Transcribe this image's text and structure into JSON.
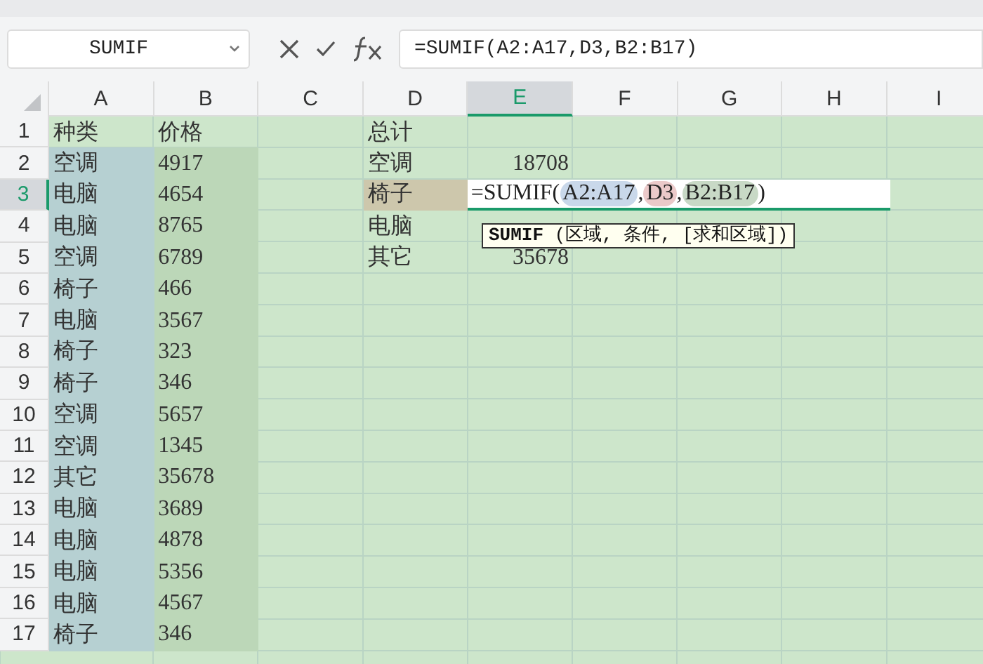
{
  "name_box": {
    "value": "SUMIF"
  },
  "formula_bar": {
    "value": "=SUMIF(A2:A17,D3,B2:B17)"
  },
  "columns": [
    {
      "label": "A",
      "selected": false
    },
    {
      "label": "B",
      "selected": false
    },
    {
      "label": "C",
      "selected": false
    },
    {
      "label": "D",
      "selected": false
    },
    {
      "label": "E",
      "selected": true
    },
    {
      "label": "F",
      "selected": false
    },
    {
      "label": "G",
      "selected": false
    },
    {
      "label": "H",
      "selected": false
    },
    {
      "label": "I",
      "selected": false
    }
  ],
  "rows": [
    {
      "label": "1",
      "selected": false,
      "cells": [
        {
          "text": "种类"
        },
        {
          "text": "价格"
        },
        null,
        {
          "text": "总计"
        }
      ]
    },
    {
      "label": "2",
      "selected": false,
      "cells": [
        {
          "text": "空调",
          "color": "#b6d0d2"
        },
        {
          "text": "4917",
          "color": "#bcd7b8"
        },
        null,
        {
          "text": "空调"
        },
        {
          "text": "18708",
          "kind": "number"
        }
      ]
    },
    {
      "label": "3",
      "selected": true,
      "cells": [
        {
          "text": "电脑",
          "color": "#b6d0d2"
        },
        {
          "text": "4654",
          "color": "#bcd7b8"
        },
        null,
        {
          "text": "椅子",
          "color": "#cdc7ac"
        }
      ],
      "editor": [
        {
          "text": "=SUMIF("
        },
        {
          "text": "A2:A17",
          "color": "#c9d8ea"
        },
        {
          "text": ","
        },
        {
          "text": "D3",
          "color": "#ebc9c9"
        },
        {
          "text": ","
        },
        {
          "text": "B2:B17",
          "color": "#c8d9c6"
        },
        {
          "text": ")"
        }
      ]
    },
    {
      "label": "4",
      "selected": false,
      "cells": [
        {
          "text": "电脑",
          "color": "#b6d0d2"
        },
        {
          "text": "8765",
          "color": "#bcd7b8"
        },
        null,
        {
          "text": "电脑"
        }
      ]
    },
    {
      "label": "5",
      "selected": false,
      "cells": [
        {
          "text": "空调",
          "color": "#b6d0d2"
        },
        {
          "text": "6789",
          "color": "#bcd7b8"
        },
        null,
        {
          "text": "其它"
        },
        {
          "text": "35678",
          "kind": "number"
        }
      ]
    },
    {
      "label": "6",
      "selected": false,
      "cells": [
        {
          "text": "椅子",
          "color": "#b6d0d2"
        },
        {
          "text": "466",
          "color": "#bcd7b8"
        }
      ]
    },
    {
      "label": "7",
      "selected": false,
      "cells": [
        {
          "text": "电脑",
          "color": "#b6d0d2"
        },
        {
          "text": "3567",
          "color": "#bcd7b8"
        }
      ]
    },
    {
      "label": "8",
      "selected": false,
      "cells": [
        {
          "text": "椅子",
          "color": "#b6d0d2"
        },
        {
          "text": "323",
          "color": "#bcd7b8"
        }
      ]
    },
    {
      "label": "9",
      "selected": false,
      "cells": [
        {
          "text": "椅子",
          "color": "#b6d0d2"
        },
        {
          "text": "346",
          "color": "#bcd7b8"
        }
      ]
    },
    {
      "label": "10",
      "selected": false,
      "cells": [
        {
          "text": "空调",
          "color": "#b6d0d2"
        },
        {
          "text": "5657",
          "color": "#bcd7b8"
        }
      ]
    },
    {
      "label": "11",
      "selected": false,
      "cells": [
        {
          "text": "空调",
          "color": "#b6d0d2"
        },
        {
          "text": "1345",
          "color": "#bcd7b8"
        }
      ]
    },
    {
      "label": "12",
      "selected": false,
      "cells": [
        {
          "text": "其它",
          "color": "#b6d0d2"
        },
        {
          "text": "35678",
          "color": "#bcd7b8"
        }
      ]
    },
    {
      "label": "13",
      "selected": false,
      "cells": [
        {
          "text": "电脑",
          "color": "#b6d0d2"
        },
        {
          "text": "3689",
          "color": "#bcd7b8"
        }
      ]
    },
    {
      "label": "14",
      "selected": false,
      "cells": [
        {
          "text": "电脑",
          "color": "#b6d0d2"
        },
        {
          "text": "4878",
          "color": "#bcd7b8"
        }
      ]
    },
    {
      "label": "15",
      "selected": false,
      "cells": [
        {
          "text": "电脑",
          "color": "#b6d0d2"
        },
        {
          "text": "5356",
          "color": "#bcd7b8"
        }
      ]
    },
    {
      "label": "16",
      "selected": false,
      "cells": [
        {
          "text": "电脑",
          "color": "#b6d0d2"
        },
        {
          "text": "4567",
          "color": "#bcd7b8"
        }
      ]
    },
    {
      "label": "17",
      "selected": false,
      "cells": [
        {
          "text": "椅子",
          "color": "#b6d0d2"
        },
        {
          "text": "346",
          "color": "#bcd7b8"
        }
      ]
    }
  ],
  "tooltip": {
    "text": "**SUMIF** (区域, 条件, [求和区域])"
  }
}
